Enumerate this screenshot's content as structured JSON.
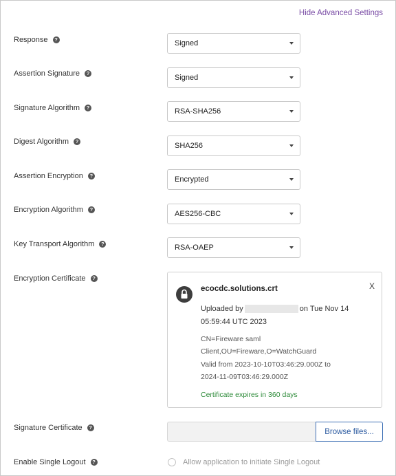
{
  "advanced_link": "Hide Advanced Settings",
  "help_glyph": "?",
  "fields": [
    {
      "label": "Response",
      "value": "Signed"
    },
    {
      "label": "Assertion Signature",
      "value": "Signed"
    },
    {
      "label": "Signature Algorithm",
      "value": "RSA-SHA256"
    },
    {
      "label": "Digest Algorithm",
      "value": "SHA256"
    },
    {
      "label": "Assertion Encryption",
      "value": "Encrypted"
    },
    {
      "label": "Encryption Algorithm",
      "value": "AES256-CBC"
    },
    {
      "label": "Key Transport Algorithm",
      "value": "RSA-OAEP"
    }
  ],
  "encryption_certificate": {
    "label": "Encryption Certificate",
    "filename": "ecocdc.solutions.crt",
    "close": "X",
    "uploaded_prefix": "Uploaded by",
    "uploaded_suffix": "on Tue Nov 14",
    "uploaded_time": "05:59:44 UTC 2023",
    "cn_line1": "CN=Fireware saml",
    "cn_line2": "Client,OU=Fireware,O=WatchGuard",
    "valid_line1": "Valid from 2023-10-10T03:46:29.000Z to",
    "valid_line2": "2024-11-09T03:46:29.000Z",
    "expires": "Certificate expires in 360 days",
    "icon": "lock-icon"
  },
  "signature_certificate": {
    "label": "Signature Certificate",
    "browse_label": "Browse files..."
  },
  "single_logout": {
    "label": "Enable Single Logout",
    "checkbox_label": "Allow application to initiate Single Logout"
  }
}
